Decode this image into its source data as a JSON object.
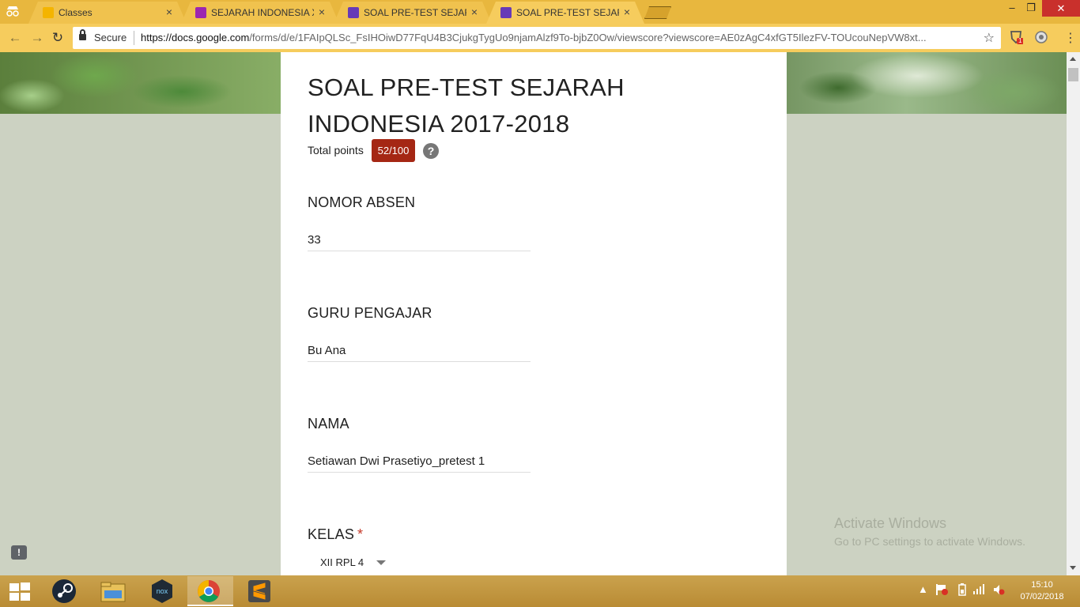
{
  "browser": {
    "tabs": [
      {
        "title": "Classes",
        "favicon_color": "#f4b400",
        "active": false
      },
      {
        "title": "SEJARAH INDONESIA XII",
        "favicon_color": "#9c27b0",
        "active": false
      },
      {
        "title": "SOAL PRE-TEST SEJARAH",
        "favicon_color": "#673ab7",
        "active": false
      },
      {
        "title": "SOAL PRE-TEST SEJARAH",
        "favicon_color": "#673ab7",
        "active": true
      }
    ],
    "close_glyph": "×",
    "secure_label": "Secure",
    "url_host": "https://docs.google.com",
    "url_path": "/forms/d/e/1FAIpQLSc_FsIHOiwD77FqU4B3CjukgTygUo9njamAlzf9To-bjbZ0Ow/viewscore?viewscore=AE0zAgC4xfGT5IlezFV-TOUcouNepVW8xt...",
    "extension_badge": "1"
  },
  "form": {
    "title": "SOAL PRE-TEST SEJARAH INDONESIA 2017-2018",
    "points_label": "Total points",
    "score": "52/100",
    "help_glyph": "?",
    "questions": [
      {
        "title": "NOMOR ABSEN",
        "answer": "33"
      },
      {
        "title": "GURU PENGAJAR",
        "answer": "Bu Ana"
      },
      {
        "title": "NAMA",
        "answer": "Setiawan Dwi Prasetiyo_pretest 1"
      },
      {
        "title": "KELAS",
        "required_mark": "*",
        "answer": "XII RPL 4"
      }
    ]
  },
  "watermark": {
    "title": "Activate Windows",
    "subtitle": "Go to PC settings to activate Windows."
  },
  "feedback_glyph": "!",
  "taskbar": {
    "time": "15:10",
    "date": "07/02/2018"
  },
  "colors": {
    "tab_strip": "#e8b73e",
    "score_badge": "#a52714",
    "page_background": "#ccd2c2"
  }
}
